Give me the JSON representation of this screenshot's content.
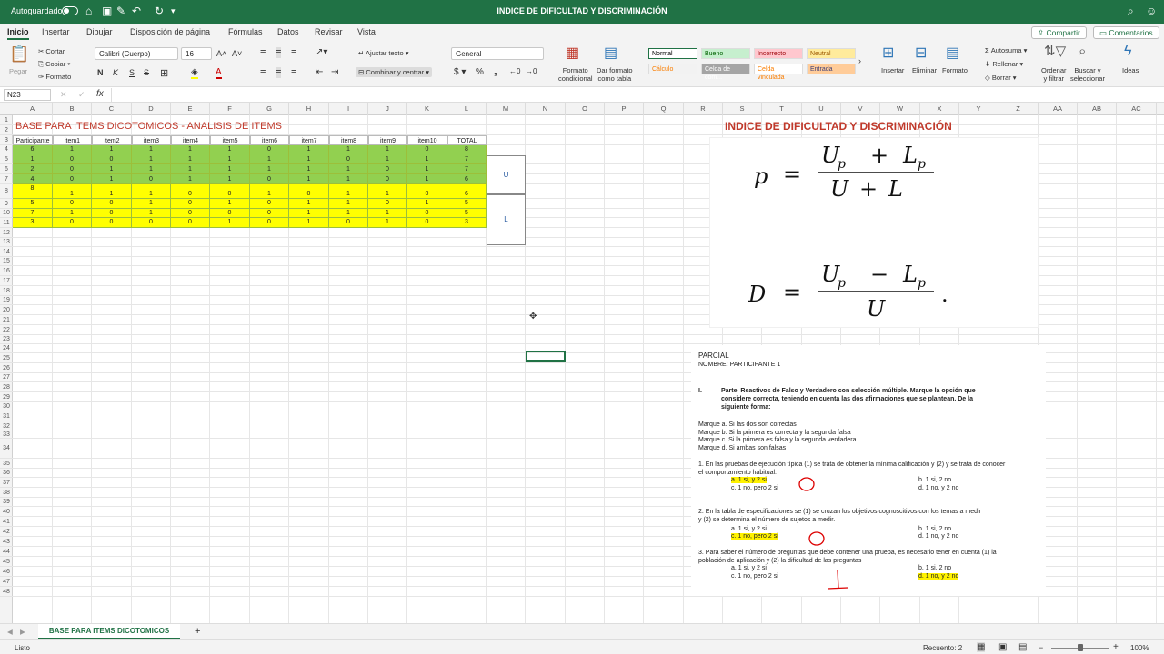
{
  "titlebar": {
    "autosave": "Autoguardado",
    "title": "INDICE DE DIFICULTAD Y DISCRIMINACIÓN"
  },
  "tabs": [
    "Inicio",
    "Insertar",
    "Dibujar",
    "Disposición de página",
    "Fórmulas",
    "Datos",
    "Revisar",
    "Vista"
  ],
  "share": "Compartir",
  "comments": "Comentarios",
  "ribbon": {
    "paste": "Pegar",
    "cut": "Cortar",
    "copy": "Copiar",
    "format": "Formato",
    "font": "Calibri (Cuerpo)",
    "size": "16",
    "wrap": "Ajustar texto",
    "merge": "Combinar y centrar",
    "numfmt": "General",
    "cond": [
      "Formato",
      "condicional"
    ],
    "astable": [
      "Dar formato",
      "como tabla"
    ],
    "styles": [
      {
        "label": "Normal",
        "bg": "#ffffff",
        "color": "#000000"
      },
      {
        "label": "Bueno",
        "bg": "#c6efce",
        "color": "#006100"
      },
      {
        "label": "Incorrecto",
        "bg": "#ffc7ce",
        "color": "#9c0006"
      },
      {
        "label": "Neutral",
        "bg": "#ffeb9c",
        "color": "#9c5700"
      },
      {
        "label": "Cálculo",
        "bg": "#f2f2f2",
        "color": "#fa7d00"
      },
      {
        "label": "Celda de com...",
        "bg": "#a5a5a5",
        "color": "#ffffff"
      },
      {
        "label": "Celda vinculada",
        "bg": "#ffffff",
        "color": "#fa7d00"
      },
      {
        "label": "Entrada",
        "bg": "#ffcc99",
        "color": "#3f3f76"
      }
    ],
    "insert": "Insertar",
    "delete": "Eliminar",
    "formatcells": "Formato",
    "autosum": "Autosuma",
    "fill": "Rellenar",
    "clear": "Borrar",
    "sort": [
      "Ordenar",
      "y filtrar"
    ],
    "find": [
      "Buscar y",
      "seleccionar"
    ],
    "ideas": "Ideas"
  },
  "namebox": "N23",
  "columns": [
    "A",
    "B",
    "C",
    "D",
    "E",
    "F",
    "G",
    "H",
    "I",
    "J",
    "K",
    "L",
    "M",
    "N",
    "O",
    "P",
    "Q",
    "R",
    "S",
    "T",
    "U",
    "V",
    "W",
    "X",
    "Y",
    "Z",
    "AA",
    "AB",
    "AC"
  ],
  "rows": [
    "1",
    "2",
    "3",
    "4",
    "5",
    "6",
    "7",
    "8",
    "9",
    "10",
    "11",
    "12",
    "13",
    "14",
    "15",
    "16",
    "17",
    "18",
    "19",
    "20",
    "21",
    "22",
    "23",
    "24",
    "25",
    "26",
    "27",
    "28",
    "29",
    "30",
    "31",
    "32",
    "33",
    "34",
    "35",
    "36",
    "37",
    "38",
    "39",
    "40",
    "41",
    "42",
    "43",
    "44",
    "45",
    "46",
    "47",
    "48"
  ],
  "table": {
    "title": "BASE PARA ITEMS DICOTOMICOS - ANALISIS DE ITEMS",
    "headers": [
      "Participante",
      "item1",
      "item2",
      "item3",
      "item4",
      "item5",
      "item6",
      "item7",
      "item8",
      "item9",
      "item10",
      "TOTAL"
    ],
    "green_rows": [
      [
        "6",
        "1",
        "1",
        "1",
        "1",
        "1",
        "0",
        "1",
        "1",
        "1",
        "0",
        "8"
      ],
      [
        "1",
        "0",
        "0",
        "1",
        "1",
        "1",
        "1",
        "1",
        "0",
        "1",
        "1",
        "7"
      ],
      [
        "2",
        "0",
        "1",
        "1",
        "1",
        "1",
        "1",
        "1",
        "1",
        "0",
        "1",
        "7"
      ],
      [
        "4",
        "0",
        "1",
        "0",
        "1",
        "1",
        "0",
        "1",
        "1",
        "0",
        "1",
        "6"
      ]
    ],
    "yellow_rows": [
      [
        "8",
        "1",
        "1",
        "1",
        "0",
        "0",
        "1",
        "0",
        "1",
        "1",
        "0",
        "6"
      ],
      [
        "5",
        "0",
        "0",
        "1",
        "0",
        "1",
        "0",
        "1",
        "1",
        "0",
        "1",
        "5"
      ],
      [
        "7",
        "1",
        "0",
        "1",
        "0",
        "0",
        "0",
        "1",
        "1",
        "1",
        "0",
        "5"
      ],
      [
        "3",
        "0",
        "0",
        "0",
        "0",
        "1",
        "0",
        "1",
        "0",
        "1",
        "0",
        "3"
      ]
    ],
    "u_label": "U",
    "l_label": "L",
    "green": "#92d050",
    "yellow": "#ffff00"
  },
  "formula_pic": {
    "title": "INDICE DE DIFICULTAD  Y DISCRIMINACIÓN"
  },
  "exam": {
    "parcial": "PARCIAL",
    "nombre": "NOMBRE:   PARTICIPANTE 1",
    "part_num": "I.",
    "part_text": [
      "Parte. Reactivos de Falso y Verdadero  con selección múltiple. Marque la opción que",
      "considere correcta,  teniendo  en cuenta las dos afirmaciones que se plantean. De la",
      "siguiente forma:"
    ],
    "marks": [
      "Marque a. Si las dos son correctas",
      "Marque b. Si la primera es correcta y la segunda falsa",
      "Marque c. Si la primera es falsa y la segunda verdadera",
      "Marque d. Si ambas son falsas"
    ],
    "q1": [
      "1.   En las pruebas de ejecución típica (1) se trata de obtener la mínima calificación y (2) y se trata de conocer",
      "      el comportamiento habitual."
    ],
    "q1opts": [
      "a. 1 si, y 2 si",
      "b. 1 si, 2 no",
      "c. 1 no, pero 2 si",
      "d. 1 no, y 2 no"
    ],
    "q2": [
      "2.   En la tabla de especificaciones se (1) se cruzan los objetivos cognoscitivos con los temas a medir",
      "      y (2) se determina el número de sujetos a medir."
    ],
    "q2opts": [
      "a. 1 si, y 2 si",
      "b. 1 si, 2 no",
      "c. 1 no, pero 2 si",
      "d. 1 no, y 2 no"
    ],
    "q3": [
      "3.   Para saber el número de preguntas que debe contener una prueba, es necesario tener en cuenta  (1) la",
      "      población de aplicación y (2)  la dificultad de las preguntas"
    ],
    "q3opts": [
      "a. 1 si, y 2 si",
      "b. 1 si, 2 no",
      "c. 1 no, pero 2 si",
      "d. 1 no, y 2 no"
    ]
  },
  "sheettab": "BASE PARA ITEMS DICOTOMICOS",
  "status": {
    "ready": "Listo",
    "count": "Recuento: 2",
    "zoom": "100%"
  }
}
